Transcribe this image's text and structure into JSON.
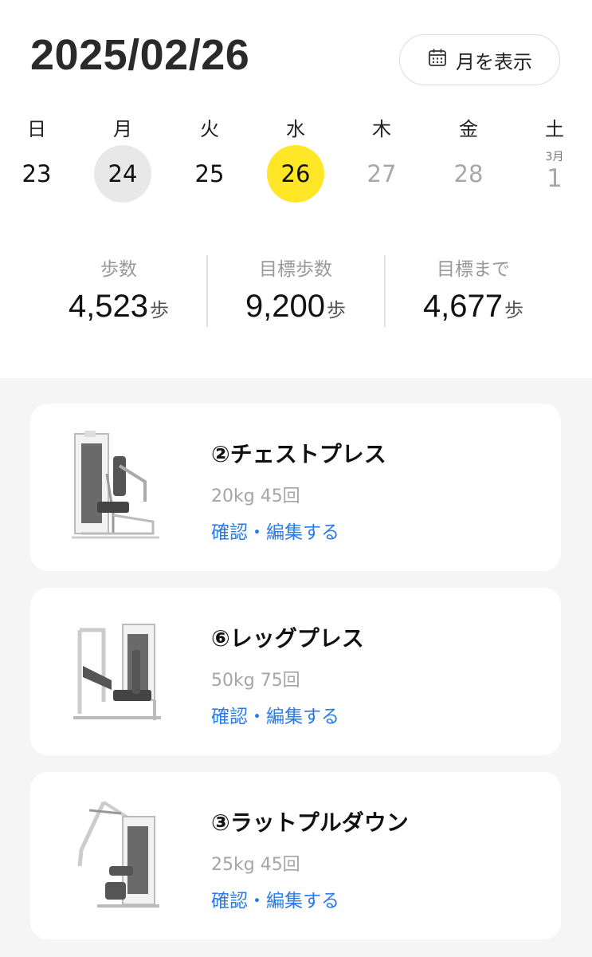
{
  "header": {
    "date": "2025/02/26",
    "month_button_label": "月を表示"
  },
  "week": {
    "weekdays": [
      "日",
      "月",
      "火",
      "水",
      "木",
      "金",
      "土"
    ],
    "days": [
      {
        "label": "23",
        "state": "normal"
      },
      {
        "label": "24",
        "state": "today"
      },
      {
        "label": "25",
        "state": "normal"
      },
      {
        "label": "26",
        "state": "selected"
      },
      {
        "label": "27",
        "state": "future"
      },
      {
        "label": "28",
        "state": "future"
      }
    ],
    "next_month_label": "3月",
    "next_month_day": "1"
  },
  "stats": [
    {
      "label": "歩数",
      "value": "4,523",
      "unit": "歩"
    },
    {
      "label": "目標歩数",
      "value": "9,200",
      "unit": "歩"
    },
    {
      "label": "目標まで",
      "value": "4,677",
      "unit": "歩"
    }
  ],
  "workouts": [
    {
      "title": "②チェストプレス",
      "detail": "20kg 45回",
      "link": "確認・編集する",
      "machine_icon": "chest-press-machine-icon"
    },
    {
      "title": "⑥レッグプレス",
      "detail": "50kg 75回",
      "link": "確認・編集する",
      "machine_icon": "leg-press-machine-icon"
    },
    {
      "title": "③ラットプルダウン",
      "detail": "25kg 45回",
      "link": "確認・編集する",
      "machine_icon": "lat-pulldown-machine-icon"
    }
  ],
  "colors": {
    "accent_yellow": "#ffe627",
    "link_blue": "#2b7be4",
    "today_gray": "#e8e8e8"
  }
}
